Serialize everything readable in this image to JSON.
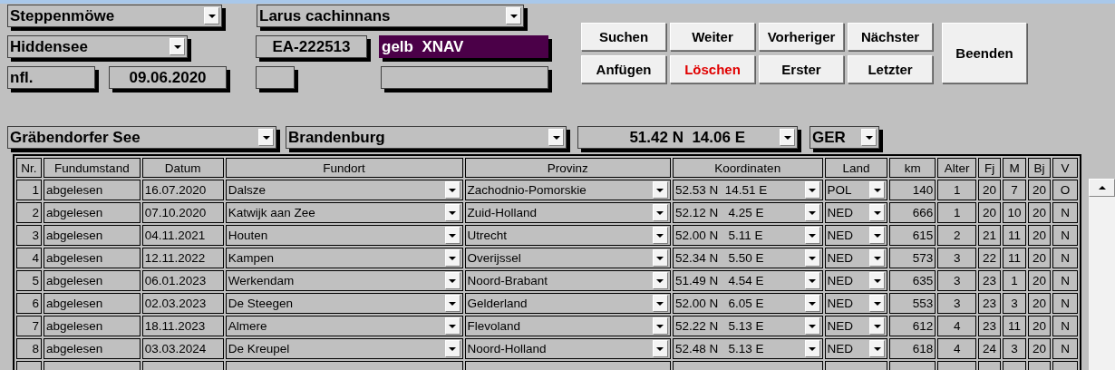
{
  "form": {
    "species": "Steppenmöwe",
    "latin_name": "Larus cachinnans",
    "ring_center": "Hiddensee",
    "ring_number": "EA-222513",
    "color_ring": "gelb  XNAV",
    "status": "nfl.",
    "date": "09.06.2020",
    "location": "Gräbendorfer See",
    "region": "Brandenburg",
    "coordinates": "51.42 N  14.06 E",
    "country": "GER"
  },
  "buttons": [
    {
      "label": "Suchen",
      "kind": "normal"
    },
    {
      "label": "Weiter",
      "kind": "normal"
    },
    {
      "label": "Vorheriger",
      "kind": "normal"
    },
    {
      "label": "Nächster",
      "kind": "normal"
    },
    {
      "label": "Beenden",
      "kind": "large"
    },
    {
      "label": "Anfügen",
      "kind": "normal"
    },
    {
      "label": "Löschen",
      "kind": "danger"
    },
    {
      "label": "Erster",
      "kind": "normal"
    },
    {
      "label": "Letzter",
      "kind": "normal"
    }
  ],
  "table": {
    "columns": [
      {
        "label": "Nr.",
        "kind": "number"
      },
      {
        "label": "Fundumstand",
        "kind": "text"
      },
      {
        "label": "Datum",
        "kind": "text"
      },
      {
        "label": "Fundort",
        "kind": "dropdown"
      },
      {
        "label": "Provinz",
        "kind": "dropdown"
      },
      {
        "label": "Koordinaten",
        "kind": "dropdown"
      },
      {
        "label": "Land",
        "kind": "dropdown"
      },
      {
        "label": "km",
        "kind": "number"
      },
      {
        "label": "Alter",
        "kind": "center"
      },
      {
        "label": "Fj",
        "kind": "center"
      },
      {
        "label": "M",
        "kind": "center"
      },
      {
        "label": "Bj",
        "kind": "center"
      },
      {
        "label": "V",
        "kind": "center"
      }
    ],
    "rows": [
      [
        "1",
        "abgelesen",
        "16.07.2020",
        "Dalsze",
        "Zachodnio-Pomorskie",
        "52.53 N  14.51 E",
        "POL",
        "140",
        "1",
        "20",
        "7",
        "20",
        "O"
      ],
      [
        "2",
        "abgelesen",
        "07.10.2020",
        "Katwijk aan Zee",
        "Zuid-Holland",
        "52.12 N   4.25 E",
        "NED",
        "666",
        "1",
        "20",
        "10",
        "20",
        "N"
      ],
      [
        "3",
        "abgelesen",
        "04.11.2021",
        "Houten",
        "Utrecht",
        "52.00 N   5.11 E",
        "NED",
        "615",
        "2",
        "21",
        "11",
        "20",
        "N"
      ],
      [
        "4",
        "abgelesen",
        "12.11.2022",
        "Kampen",
        "Overijssel",
        "52.34 N   5.50 E",
        "NED",
        "573",
        "3",
        "22",
        "11",
        "20",
        "N"
      ],
      [
        "5",
        "abgelesen",
        "06.01.2023",
        "Werkendam",
        "Noord-Brabant",
        "51.49 N   4.54 E",
        "NED",
        "635",
        "3",
        "23",
        "1",
        "20",
        "N"
      ],
      [
        "6",
        "abgelesen",
        "02.03.2023",
        "De Steegen",
        "Gelderland",
        "52.00 N   6.05 E",
        "NED",
        "553",
        "3",
        "23",
        "3",
        "20",
        "N"
      ],
      [
        "7",
        "abgelesen",
        "18.11.2023",
        "Almere",
        "Flevoland",
        "52.22 N   5.13 E",
        "NED",
        "612",
        "4",
        "23",
        "11",
        "20",
        "N"
      ],
      [
        "8",
        "abgelesen",
        "03.03.2024",
        "De Kreupel",
        "Noord-Holland",
        "52.48 N   5.13 E",
        "NED",
        "618",
        "4",
        "24",
        "3",
        "20",
        "N"
      ]
    ]
  }
}
